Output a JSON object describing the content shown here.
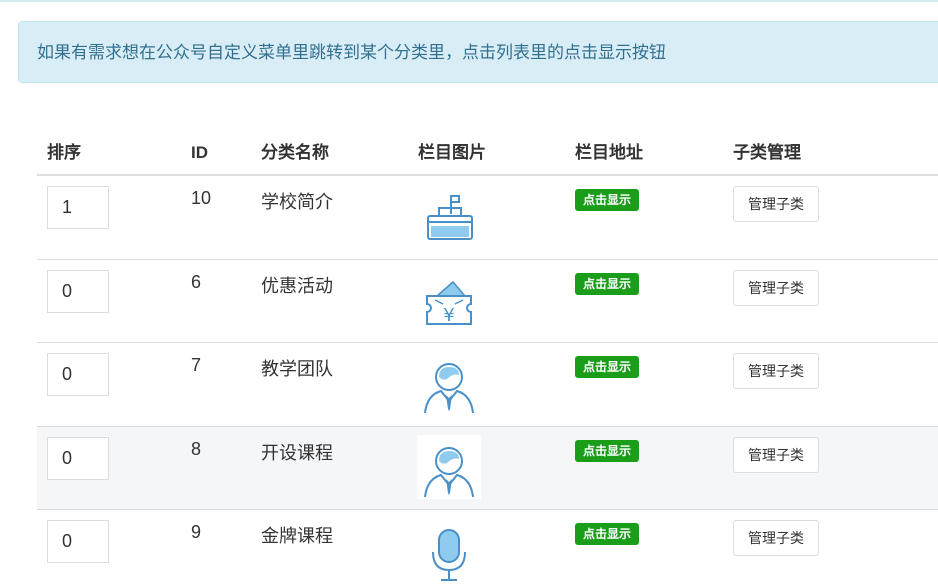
{
  "notice": {
    "text": "如果有需求想在公众号自定义菜单里跳转到某个分类里，点击列表里的点击显示按钮"
  },
  "table": {
    "headers": {
      "order": "排序",
      "id": "ID",
      "name": "分类名称",
      "image": "栏目图片",
      "url": "栏目地址",
      "children": "子类管理"
    },
    "rows": [
      {
        "order": "1",
        "id": "10",
        "name": "学校简介",
        "icon": "school-building-icon",
        "show_label": "点击显示",
        "manage_label": "管理子类"
      },
      {
        "order": "0",
        "id": "6",
        "name": "优惠活动",
        "icon": "coupon-ticket-icon",
        "show_label": "点击显示",
        "manage_label": "管理子类"
      },
      {
        "order": "0",
        "id": "7",
        "name": "教学团队",
        "icon": "teacher-person-icon",
        "show_label": "点击显示",
        "manage_label": "管理子类"
      },
      {
        "order": "0",
        "id": "8",
        "name": "开设课程",
        "icon": "teacher-person-icon",
        "show_label": "点击显示",
        "manage_label": "管理子类"
      },
      {
        "order": "0",
        "id": "9",
        "name": "金牌课程",
        "icon": "microphone-icon",
        "show_label": "点击显示",
        "manage_label": "管理子类"
      }
    ]
  },
  "colors": {
    "notice_bg": "#d9edf7",
    "notice_text": "#31708f",
    "badge_green": "#1a9e1a",
    "icon_blue": "#4a90c8",
    "icon_fill": "#8fcbee"
  }
}
